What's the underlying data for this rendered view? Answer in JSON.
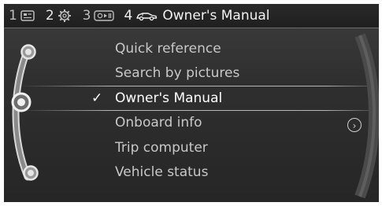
{
  "tabs": [
    {
      "number": "1",
      "icon": "screen-list-icon"
    },
    {
      "number": "2",
      "icon": "gear-icon"
    },
    {
      "number": "3",
      "icon": "media-icon"
    },
    {
      "number": "4",
      "icon": "car-icon",
      "title": "Owner's Manual"
    }
  ],
  "menu": {
    "items": [
      {
        "label": "Quick reference"
      },
      {
        "label": "Search by pictures"
      },
      {
        "label": "Owner's Manual",
        "selected": true
      },
      {
        "label": "Onboard info"
      },
      {
        "label": "Trip computer"
      },
      {
        "label": "Vehicle status"
      }
    ],
    "check_glyph": "✓"
  },
  "more_arrow": "›",
  "colors": {
    "background": "#2f2f2f",
    "text": "#c8c8c8",
    "selected_text": "#ffffff"
  }
}
